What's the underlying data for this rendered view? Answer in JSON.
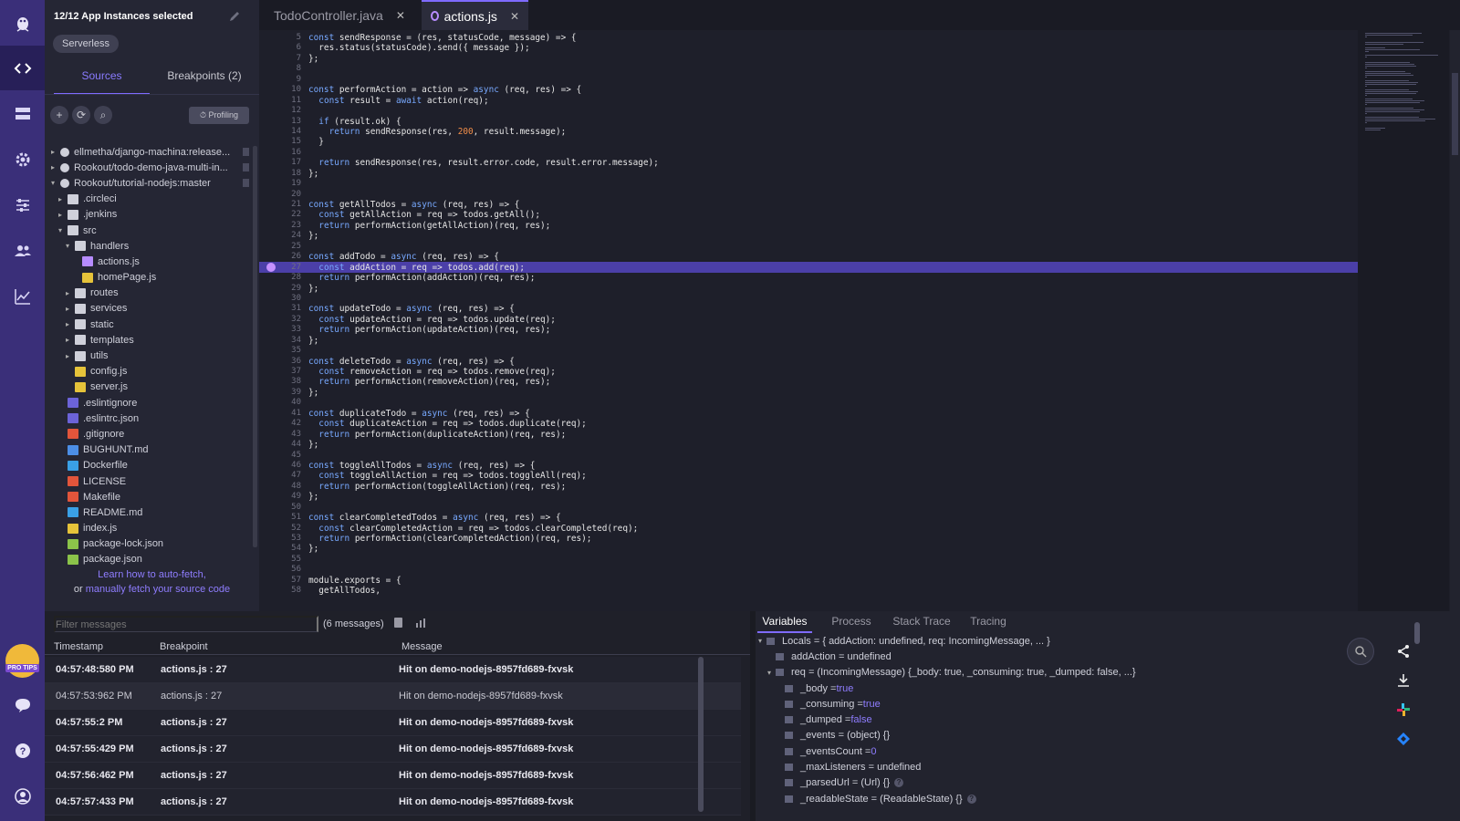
{
  "header": {
    "app_instances": "12/12 App Instances selected",
    "serverless_badge": "Serverless"
  },
  "sidebar_tabs": {
    "sources": "Sources",
    "breakpoints": "Breakpoints (2)"
  },
  "toolbar": {
    "profiling": "Profiling"
  },
  "file_tree": [
    {
      "label": "ellmetha/django-machina:release...",
      "icon": "github-icon"
    },
    {
      "label": "Rookout/todo-demo-java-multi-in...",
      "icon": "github-icon"
    },
    {
      "label": "Rookout/tutorial-nodejs:master",
      "icon": "github-icon"
    },
    {
      "label": ".circleci",
      "icon": "folder-icon"
    },
    {
      "label": ".jenkins",
      "icon": "folder-icon"
    },
    {
      "label": "src",
      "icon": "folder-icon"
    },
    {
      "label": "handlers",
      "icon": "folder-icon"
    },
    {
      "label": "actions.js",
      "icon": "breakpoint-file-icon"
    },
    {
      "label": "homePage.js",
      "icon": "js-file-icon"
    },
    {
      "label": "routes",
      "icon": "folder-icon"
    },
    {
      "label": "services",
      "icon": "folder-icon"
    },
    {
      "label": "static",
      "icon": "folder-icon"
    },
    {
      "label": "templates",
      "icon": "folder-icon"
    },
    {
      "label": "utils",
      "icon": "folder-icon"
    },
    {
      "label": "config.js",
      "icon": "js-file-icon"
    },
    {
      "label": "server.js",
      "icon": "js-file-icon"
    },
    {
      "label": ".eslintignore",
      "icon": "eslint-file-icon"
    },
    {
      "label": ".eslintrc.json",
      "icon": "eslint-file-icon"
    },
    {
      "label": ".gitignore",
      "icon": "git-file-icon"
    },
    {
      "label": "BUGHUNT.md",
      "icon": "markdown-file-icon"
    },
    {
      "label": "Dockerfile",
      "icon": "docker-file-icon"
    },
    {
      "label": "LICENSE",
      "icon": "license-file-icon"
    },
    {
      "label": "Makefile",
      "icon": "makefile-icon"
    },
    {
      "label": "README.md",
      "icon": "info-file-icon"
    },
    {
      "label": "index.js",
      "icon": "js-file-icon"
    },
    {
      "label": "package-lock.json",
      "icon": "npm-file-icon"
    },
    {
      "label": "package.json",
      "icon": "npm-file-icon"
    }
  ],
  "autofetch": {
    "link1": "Learn how to auto-fetch,",
    "or": "or ",
    "link2": "manually fetch your source code"
  },
  "editor_tabs": {
    "tab1": "TodoController.java",
    "tab2": "actions.js",
    "close": "✕"
  },
  "code": {
    "line_numbers": [
      "5",
      "6",
      "7",
      "8",
      "9",
      "10",
      "11",
      "12",
      "13",
      "14",
      "15",
      "16",
      "17",
      "18",
      "19",
      "20",
      "21",
      "22",
      "23",
      "24",
      "25",
      "26",
      "27",
      "28",
      "29",
      "30",
      "31",
      "32",
      "33",
      "34",
      "35",
      "36",
      "37",
      "38",
      "39",
      "40",
      "41",
      "42",
      "43",
      "44",
      "45",
      "46",
      "47",
      "48",
      "49",
      "50",
      "51",
      "52",
      "53",
      "54",
      "55",
      "56",
      "57",
      "58"
    ],
    "lines": [
      "const sendResponse = (res, statusCode, message) => {",
      "  res.status(statusCode).send({ message });",
      "};",
      "",
      "",
      "const performAction = action => async (req, res) => {",
      "  const result = await action(req);",
      "",
      "  if (result.ok) {",
      "    return sendResponse(res, 200, result.message);",
      "  }",
      "",
      "  return sendResponse(res, result.error.code, result.error.message);",
      "};",
      "",
      "",
      "const getAllTodos = async (req, res) => {",
      "  const getAllAction = req => todos.getAll();",
      "  return performAction(getAllAction)(req, res);",
      "};",
      "",
      "const addTodo = async (req, res) => {",
      "  const addAction = req => todos.add(req);",
      "  return performAction(addAction)(req, res);",
      "};",
      "",
      "const updateTodo = async (req, res) => {",
      "  const updateAction = req => todos.update(req);",
      "  return performAction(updateAction)(req, res);",
      "};",
      "",
      "const deleteTodo = async (req, res) => {",
      "  const removeAction = req => todos.remove(req);",
      "  return performAction(removeAction)(req, res);",
      "};",
      "",
      "const duplicateTodo = async (req, res) => {",
      "  const duplicateAction = req => todos.duplicate(req);",
      "  return performAction(duplicateAction)(req, res);",
      "};",
      "",
      "const toggleAllTodos = async (req, res) => {",
      "  const toggleAllAction = req => todos.toggleAll(req);",
      "  return performAction(toggleAllAction)(req, res);",
      "};",
      "",
      "const clearCompletedTodos = async (req, res) => {",
      "  const clearCompletedAction = req => todos.clearCompleted(req);",
      "  return performAction(clearCompletedAction)(req, res);",
      "};",
      "",
      "",
      "module.exports = {",
      "  getAllTodos,"
    ]
  },
  "messages": {
    "filter_placeholder": "Filter messages",
    "count": "(6 messages)",
    "headers": {
      "timestamp": "Timestamp",
      "breakpoint": "Breakpoint",
      "message": "Message"
    },
    "rows": [
      {
        "timestamp": "04:57:48:580 PM",
        "breakpoint": "actions.js : 27",
        "message": "Hit on demo-nodejs-8957fd689-fxvsk"
      },
      {
        "timestamp": "04:57:53:962 PM",
        "breakpoint": "actions.js : 27",
        "message": "Hit on demo-nodejs-8957fd689-fxvsk"
      },
      {
        "timestamp": "04:57:55:2 PM",
        "breakpoint": "actions.js : 27",
        "message": "Hit on demo-nodejs-8957fd689-fxvsk"
      },
      {
        "timestamp": "04:57:55:429 PM",
        "breakpoint": "actions.js : 27",
        "message": "Hit on demo-nodejs-8957fd689-fxvsk"
      },
      {
        "timestamp": "04:57:56:462 PM",
        "breakpoint": "actions.js : 27",
        "message": "Hit on demo-nodejs-8957fd689-fxvsk"
      },
      {
        "timestamp": "04:57:57:433 PM",
        "breakpoint": "actions.js : 27",
        "message": "Hit on demo-nodejs-8957fd689-fxvsk"
      }
    ]
  },
  "debug": {
    "tabs": {
      "variables": "Variables",
      "process": "Process",
      "stack_trace": "Stack Trace",
      "tracing": "Tracing"
    },
    "vars": [
      {
        "name": "Locals = { addAction: undefined, req: IncomingMessage, ... }",
        "value": "",
        "level": 0,
        "caret": "▾"
      },
      {
        "name": "addAction = undefined",
        "value": "",
        "level": 1,
        "caret": ""
      },
      {
        "name": "req = (IncomingMessage) {_body: true, _consuming: true, _dumped: false, ...}",
        "value": "",
        "level": 1,
        "caret": "▾"
      },
      {
        "name": "_body = ",
        "value": "true",
        "level": 2,
        "caret": ""
      },
      {
        "name": "_consuming = ",
        "value": "true",
        "level": 2,
        "caret": ""
      },
      {
        "name": "_dumped = ",
        "value": "false",
        "level": 2,
        "caret": ""
      },
      {
        "name": "_events = (object) {}",
        "value": "",
        "level": 2,
        "caret": ""
      },
      {
        "name": "_eventsCount = ",
        "value": "0",
        "level": 2,
        "caret": ""
      },
      {
        "name": "_maxListeners = undefined",
        "value": "",
        "level": 2,
        "caret": ""
      },
      {
        "name": "_parsedUrl = (Url) {}",
        "value": "",
        "level": 2,
        "caret": "",
        "help": "?"
      },
      {
        "name": "_readableState = (ReadableState) {}",
        "value": "",
        "level": 2,
        "caret": "",
        "help": "?"
      }
    ]
  },
  "colors": {
    "accent": "#7f6bff",
    "rail": "#3a2f79",
    "highlight_line": "#4b3fa8"
  }
}
